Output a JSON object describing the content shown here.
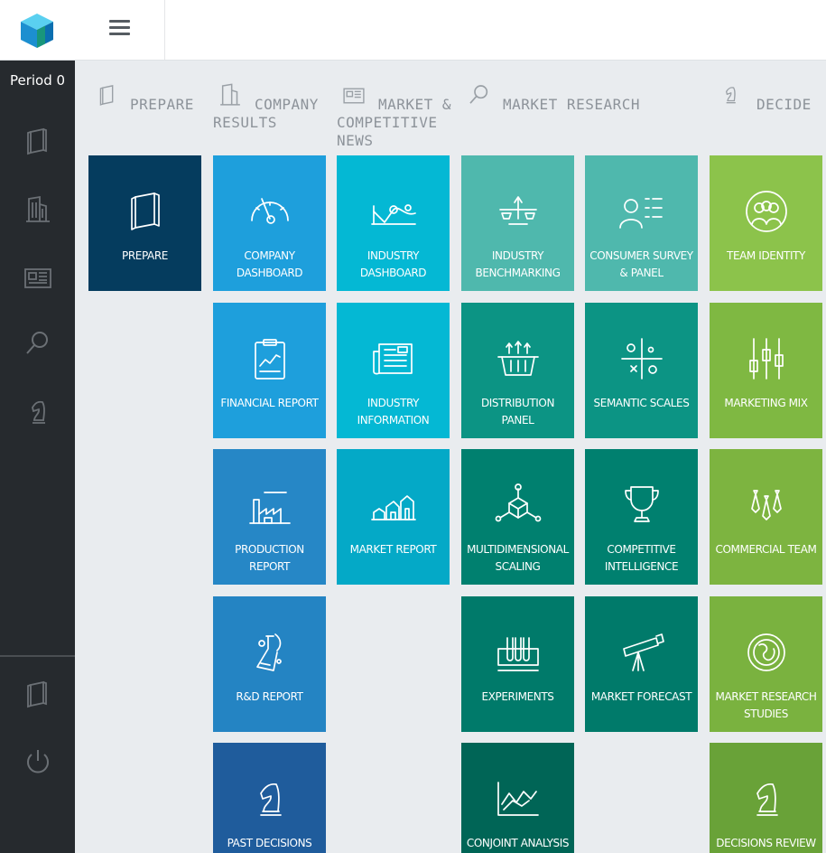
{
  "app": {
    "period_label": "Period 0",
    "logo_icon": "cube-logo-icon"
  },
  "colors": {
    "sidebar": "#262a2e",
    "prepare": "#053c5e",
    "company": "#1e9fdc",
    "market": "#04b8d4",
    "research_light": "#4fb8ad",
    "research_dark": "#00786a",
    "decide": "#8cc34b"
  },
  "sidebar": {
    "items": [
      {
        "icon": "book-icon"
      },
      {
        "icon": "building-icon"
      },
      {
        "icon": "newspaper-icon"
      },
      {
        "icon": "magnifier-icon"
      },
      {
        "icon": "chess-knight-icon"
      }
    ],
    "bottom_items": [
      {
        "icon": "book-icon"
      },
      {
        "icon": "power-icon"
      }
    ]
  },
  "headers": [
    {
      "label": "PREPARE",
      "icon": "book-icon"
    },
    {
      "label": "COMPANY\nRESULTS",
      "icon": "building-icon"
    },
    {
      "label": "MARKET &\nCOMPETITIVE\nNEWS",
      "icon": "newspaper-icon"
    },
    {
      "label": "MARKET RESEARCH",
      "icon": "magnifier-icon"
    },
    {
      "label": "DECIDE",
      "icon": "chess-knight-icon"
    }
  ],
  "tiles": {
    "prepare": "PREPARE",
    "company_dashboard": "COMPANY DASHBOARD",
    "financial_report": "FINANCIAL REPORT",
    "production_report": "PRODUCTION REPORT",
    "rd_report": "R&D REPORT",
    "past_decisions": "PAST DECISIONS",
    "industry_dashboard": "INDUSTRY DASHBOARD",
    "industry_information": "INDUSTRY INFORMATION",
    "market_report": "MARKET REPORT",
    "industry_benchmarking": "INDUSTRY BENCHMARKING",
    "distribution_panel": "DISTRIBUTION PANEL",
    "multidimensional_scaling": "MULTIDIMENSIONAL SCALING",
    "experiments": "EXPERIMENTS",
    "conjoint_analysis": "CONJOINT ANALYSIS",
    "consumer_survey": "CONSUMER SURVEY & PANEL",
    "semantic_scales": "SEMANTIC SCALES",
    "competitive_intelligence": "COMPETITIVE INTELLIGENCE",
    "market_forecast": "MARKET FORECAST",
    "team_identity": "TEAM IDENTITY",
    "marketing_mix": "MARKETING MIX",
    "commercial_team": "COMMERCIAL TEAM",
    "market_research_studies": "MARKET RESEARCH STUDIES",
    "decisions_review": "DECISIONS REVIEW"
  }
}
